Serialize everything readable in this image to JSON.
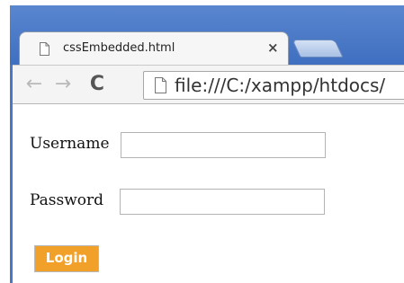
{
  "tab": {
    "title": "cssEmbedded.html",
    "close_glyph": "×",
    "icon": "page-icon"
  },
  "toolbar": {
    "back_glyph": "←",
    "forward_glyph": "→",
    "reload_glyph": "C",
    "url": "file:///C:/xampp/htdocs/"
  },
  "form": {
    "username_label": "Username",
    "password_label": "Password",
    "username_value": "",
    "password_value": "",
    "login_label": "Login"
  },
  "colors": {
    "chrome_blue": "#4a78c6",
    "login_button": "#f1a02a"
  }
}
